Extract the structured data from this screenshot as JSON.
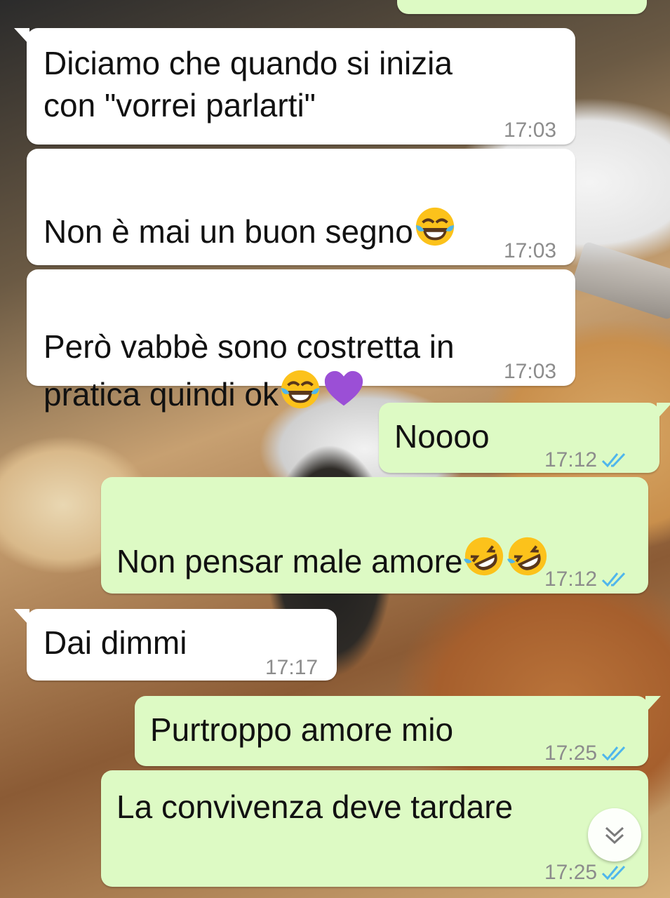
{
  "chat": {
    "messages": [
      {
        "direction": "incoming",
        "text": "Diciamo che quando si inizia\ncon \"vorrei parlarti\"",
        "time": "17:03"
      },
      {
        "direction": "incoming",
        "text": "Non è mai un buon segno",
        "emoji": [
          "face-with-tears-of-joy"
        ],
        "time": "17:03"
      },
      {
        "direction": "incoming",
        "text": "Però vabbè sono costretta in\npratica quindi ok",
        "emoji": [
          "face-with-tears-of-joy",
          "purple-heart"
        ],
        "time": "17:03"
      },
      {
        "direction": "outgoing",
        "text": "Noooo",
        "time": "17:12",
        "status": "read"
      },
      {
        "direction": "outgoing",
        "text": "Non pensar male amore",
        "emoji": [
          "rolling-on-the-floor-laughing",
          "rolling-on-the-floor-laughing"
        ],
        "time": "17:12",
        "status": "read"
      },
      {
        "direction": "incoming",
        "text": "Dai dimmi",
        "time": "17:17"
      },
      {
        "direction": "outgoing",
        "text": "Purtroppo amore mio",
        "time": "17:25",
        "status": "read"
      },
      {
        "direction": "outgoing",
        "text": "La convivenza deve tardare",
        "time": "17:25",
        "status": "read"
      }
    ]
  },
  "colors": {
    "incoming_bubble": "#ffffff",
    "outgoing_bubble": "#ddfac4",
    "read_ticks": "#4fb6ec",
    "timestamp": "#8c8c8c"
  },
  "icons": {
    "read_receipt": "double-check-icon",
    "scroll_down": "double-chevron-down-icon"
  }
}
